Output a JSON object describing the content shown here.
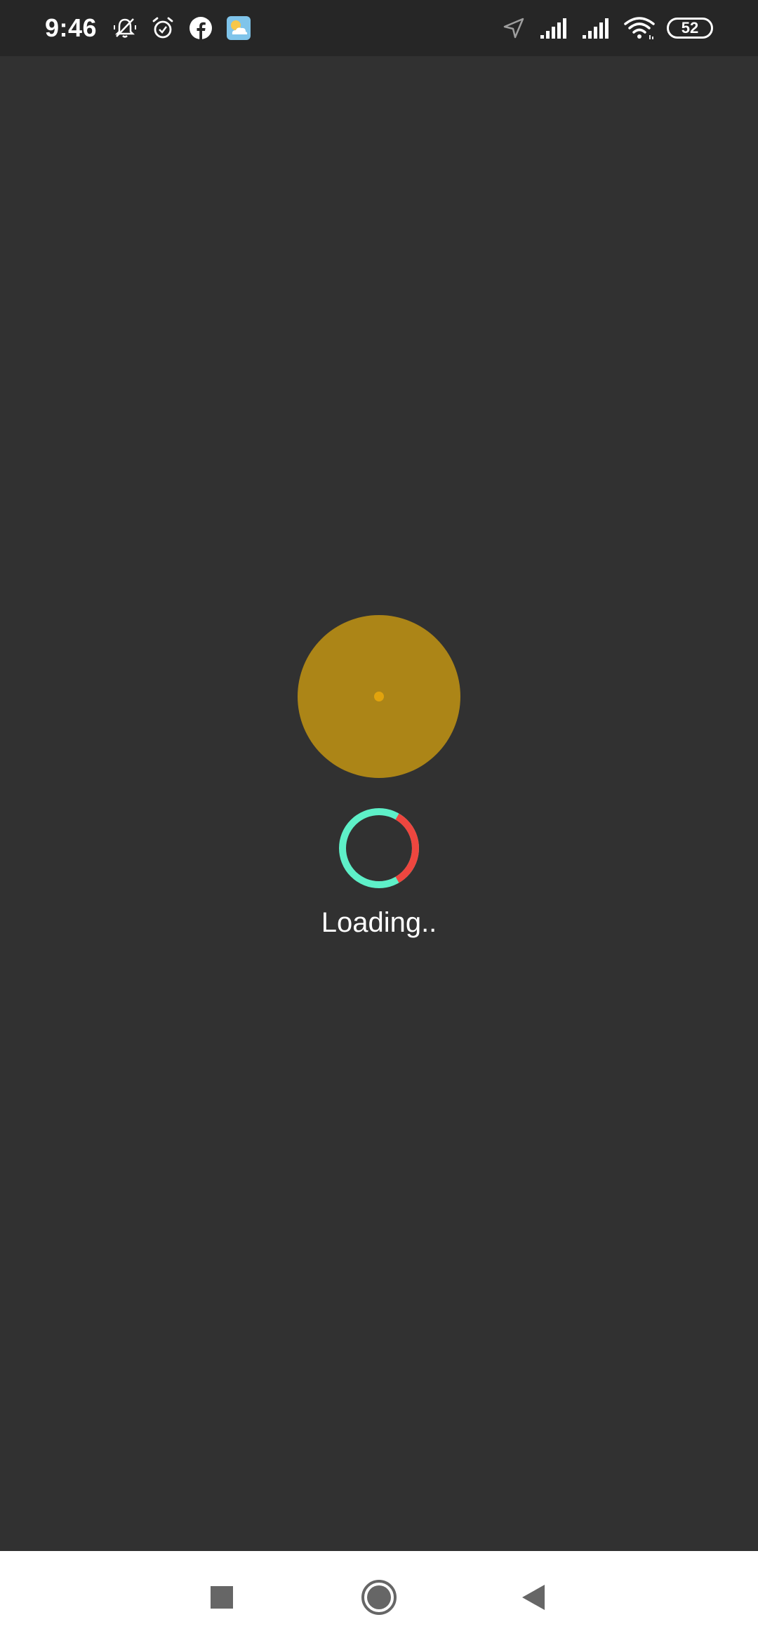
{
  "status_bar": {
    "time": "9:46",
    "left_icons": [
      "silent-bell-icon",
      "alarm-icon",
      "facebook-icon",
      "weather-icon"
    ],
    "right_icons": [
      "location-icon",
      "signal-icon",
      "signal-icon",
      "wifi-icon"
    ],
    "battery_level": "52"
  },
  "main": {
    "loading_label": "Loading..",
    "colors": {
      "background": "#313131",
      "sun_circle": "#ac8517",
      "sun_dot": "#e1a30d",
      "spinner_primary": "#5ef0c8",
      "spinner_secondary": "#ee463f"
    }
  },
  "nav_bar": {
    "buttons": [
      "recents-square-icon",
      "home-circle-icon",
      "back-triangle-icon"
    ]
  }
}
